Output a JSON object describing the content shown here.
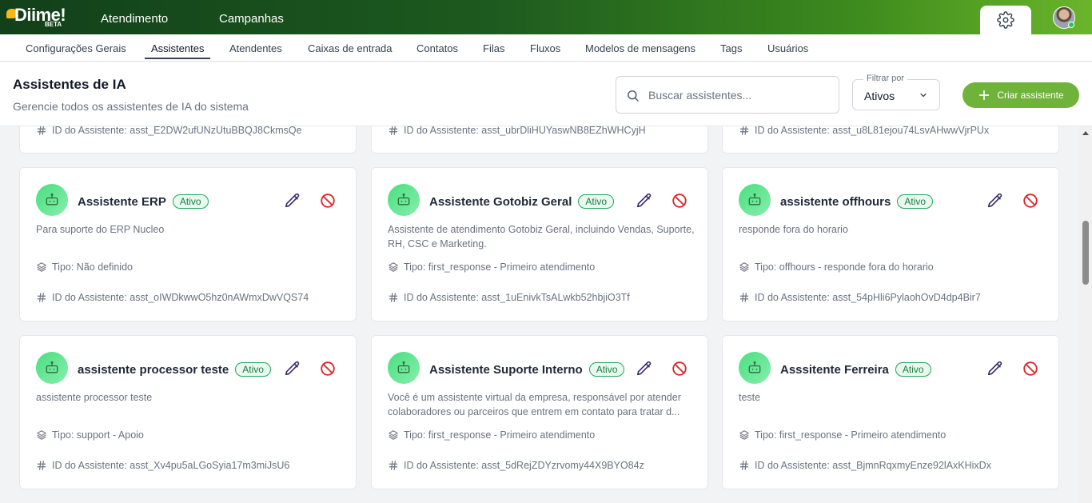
{
  "brand": {
    "name": "Diime!",
    "tag": "BETA"
  },
  "topnav": {
    "items": [
      "Atendimento",
      "Campanhas"
    ]
  },
  "subnav": {
    "items": [
      "Configurações Gerais",
      "Assistentes",
      "Atendentes",
      "Caixas de entrada",
      "Contatos",
      "Filas",
      "Fluxos",
      "Modelos de mensagens",
      "Tags",
      "Usuários"
    ],
    "active": "Assistentes"
  },
  "header": {
    "title": "Assistentes de IA",
    "subtitle": "Gerencie todos os assistentes de IA do sistema",
    "search_placeholder": "Buscar assistentes...",
    "filter_label": "Filtrar por",
    "filter_value": "Ativos",
    "create_label": "Criar assistente"
  },
  "partial_cards": [
    {
      "id_text": "ID do Assistente: asst_E2DW2ufUNzUtuBBQJ8CkmsQe"
    },
    {
      "id_text": "ID do Assistente: asst_ubrDliHUYaswNB8EZhWHCyjH"
    },
    {
      "id_text": "ID do Assistente: asst_u8L81ejou74LsvAHwwVjrPUx"
    }
  ],
  "cards": [
    {
      "name": "Assistente ERP",
      "status": "Ativo",
      "description": "Para suporte do ERP Nucleo",
      "type_text": "Tipo: Não definido",
      "id_text": "ID do Assistente: asst_oIWDkwwO5hz0nAWmxDwVQS74"
    },
    {
      "name": "Assistente Gotobiz Geral",
      "status": "Ativo",
      "description": "Assistente de atendimento Gotobiz Geral, incluindo Vendas, Suporte, RH, CSC e Marketing.",
      "type_text": "Tipo: first_response - Primeiro atendimento",
      "id_text": "ID do Assistente: asst_1uEnivkTsALwkb52hbjiO3Tf"
    },
    {
      "name": "assistente offhours",
      "status": "Ativo",
      "description": "responde fora do horario",
      "type_text": "Tipo: offhours - responde fora do horario",
      "id_text": "ID do Assistente: asst_54pHli6PylaohOvD4dp4Bir7"
    },
    {
      "name": "assistente processor teste",
      "status": "Ativo",
      "description": "assistente processor teste",
      "type_text": "Tipo: support - Apoio",
      "id_text": "ID do Assistente: asst_Xv4pu5aLGoSyia17m3miJsU6"
    },
    {
      "name": "Assistente Suporte Interno",
      "status": "Ativo",
      "description": "Você é um assistente virtual da empresa, responsável por atender colaboradores ou parceiros que entrem em contato para tratar d...",
      "type_text": "Tipo: first_response - Primeiro atendimento",
      "id_text": "ID do Assistente: asst_5dRejZDYzrvomy44X9BYO84z"
    },
    {
      "name": "Asssitente Ferreira",
      "status": "Ativo",
      "description": "teste",
      "type_text": "Tipo: first_response - Primeiro atendimento",
      "id_text": "ID do Assistente: asst_BjmnRqxmyEnze92lAxKHixDx"
    }
  ],
  "colors": {
    "accent": "#6fb33a",
    "badge_border": "#22a55a",
    "danger": "#dc2626",
    "edit": "#3b2a6b"
  }
}
